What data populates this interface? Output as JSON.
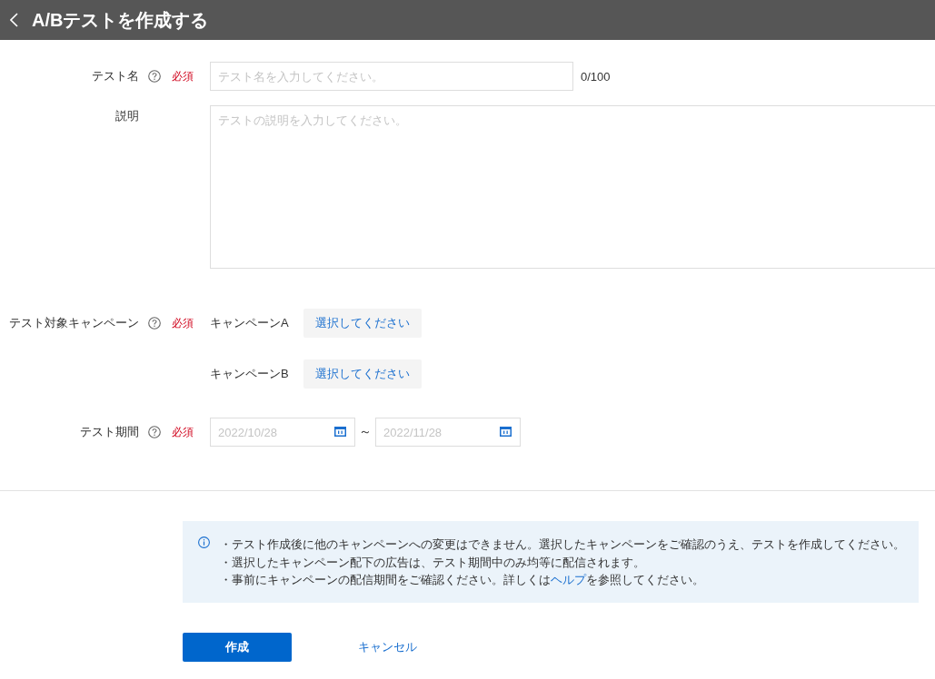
{
  "header": {
    "title": "A/Bテストを作成する"
  },
  "fields": [
    {
      "kind": "text",
      "label": "テスト名",
      "help": true,
      "required_label": "必須",
      "placeholder": "テスト名を入力してください。",
      "counter": "0/100"
    },
    {
      "kind": "textarea",
      "label": "説明",
      "help": false,
      "placeholder": "テストの説明を入力してください。"
    },
    {
      "kind": "campaigns",
      "label": "テスト対象キャンペーン",
      "help": true,
      "required_label": "必須",
      "campaigns": [
        {
          "name": "キャンペーンA",
          "button": "選択してください"
        },
        {
          "name": "キャンペーンB",
          "button": "選択してください"
        }
      ]
    },
    {
      "kind": "date_range",
      "label": "テスト期間",
      "help": true,
      "required_label": "必須",
      "start_placeholder": "2022/10/28",
      "separator": "～",
      "end_placeholder": "2022/11/28"
    }
  ],
  "notice": {
    "lines": [
      {
        "text": "・テスト作成後に他のキャンペーンへの変更はできません。選択したキャンペーンをご確認のうえ、テストを作成してください。"
      },
      {
        "text": "・選択したキャンペーン配下の広告は、テスト期間中のみ均等に配信されます。"
      },
      {
        "text": "・事前にキャンペーンの配信期間をご確認ください。詳しくは",
        "link": "ヘルプ",
        "after": "を参照してください。"
      }
    ]
  },
  "buttons": [
    {
      "kind": "primary",
      "label": "作成"
    },
    {
      "kind": "link",
      "label": "キャンセル"
    }
  ]
}
